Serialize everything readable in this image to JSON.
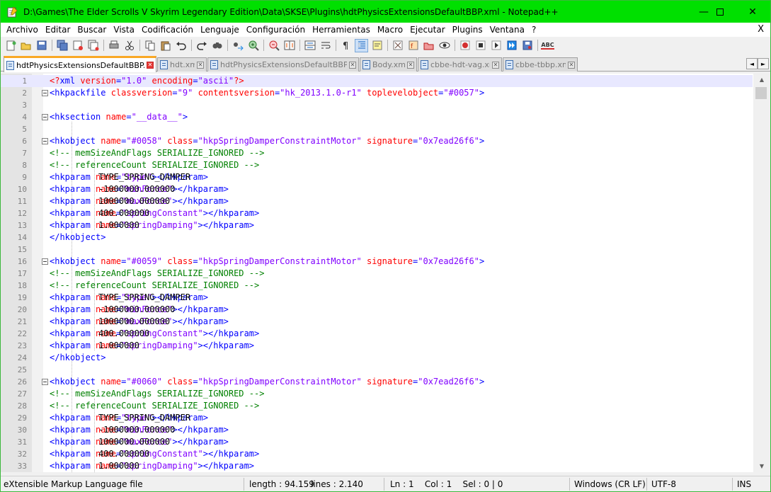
{
  "window": {
    "title": "D:\\Games\\The Elder Scrolls V Skyrim Legendary Edition\\Data\\SKSE\\Plugins\\hdtPhysicsExtensionsDefaultBBP.xml - Notepad++",
    "minimize_glyph": "—",
    "maximize_glyph": "☐",
    "close_glyph": "✕"
  },
  "menu": {
    "items": [
      "Archivo",
      "Editar",
      "Buscar",
      "Vista",
      "Codificación",
      "Lenguaje",
      "Configuración",
      "Herramientas",
      "Macro",
      "Ejecutar",
      "Plugins",
      "Ventana",
      "?"
    ],
    "close_doc": "X"
  },
  "toolbar": {
    "icons": [
      "new-file-icon",
      "open-file-icon",
      "save-icon",
      "save-all-icon",
      "close-icon",
      "close-all-icon",
      "print-icon",
      "cut-icon",
      "copy-icon",
      "paste-icon",
      "undo-icon",
      "redo-icon",
      "find-icon",
      "replace-icon",
      "zoom-in-icon",
      "zoom-out-icon",
      "sync-vertical-icon",
      "sync-horizontal-icon",
      "word-wrap-icon",
      "show-all-chars-icon",
      "indent-guide-icon",
      "language-icon",
      "doc-map-icon",
      "function-list-icon",
      "folder-workspace-icon",
      "monitoring-icon",
      "record-macro-icon",
      "stop-record-icon",
      "play-macro-icon",
      "play-multiple-icon",
      "save-macro-icon",
      "spellcheck-icon"
    ],
    "spellcheck_label": "ABC"
  },
  "tabs": [
    {
      "label": "hdtPhysicsExtensionsDefaultBBP.xml",
      "active": true
    },
    {
      "label": "hdt.xml",
      "active": false
    },
    {
      "label": "hdtPhysicsExtensionsDefaultBBP.xml",
      "active": false
    },
    {
      "label": "Body.xml",
      "active": false
    },
    {
      "label": "cbbe-hdt-vag.xml",
      "active": false
    },
    {
      "label": "cbbe-tbbp.xml",
      "active": false
    }
  ],
  "tab_nav": {
    "prev": "◄",
    "next": "►"
  },
  "editor": {
    "current_line": 1,
    "lines": [
      {
        "n": "1",
        "seg": [
          [
            "pi",
            "<?"
          ],
          [
            "tag",
            "xml "
          ],
          [
            "att",
            "version"
          ],
          [
            "tag",
            "="
          ],
          [
            "val",
            "\"1.0\""
          ],
          [
            "tag",
            " "
          ],
          [
            "att",
            "encoding"
          ],
          [
            "tag",
            "="
          ],
          [
            "val",
            "\"ascii\""
          ],
          [
            "pi",
            "?>"
          ]
        ]
      },
      {
        "n": "2",
        "seg": [
          [
            "tag",
            "<hkpackfile "
          ],
          [
            "att",
            "classversion"
          ],
          [
            "tag",
            "="
          ],
          [
            "val",
            "\"9\""
          ],
          [
            "tag",
            " "
          ],
          [
            "att",
            "contentsversion"
          ],
          [
            "tag",
            "="
          ],
          [
            "val",
            "\"hk_2013.1.0-r1\""
          ],
          [
            "tag",
            " "
          ],
          [
            "att",
            "toplevelobject"
          ],
          [
            "tag",
            "="
          ],
          [
            "val",
            "\"#0057\""
          ],
          [
            "tag",
            ">"
          ]
        ]
      },
      {
        "n": "3",
        "seg": []
      },
      {
        "n": "4",
        "seg": [
          [
            "txt",
            "    "
          ],
          [
            "tag",
            "<hksection "
          ],
          [
            "att",
            "name"
          ],
          [
            "tag",
            "="
          ],
          [
            "val",
            "\"__data__\""
          ],
          [
            "tag",
            ">"
          ]
        ]
      },
      {
        "n": "5",
        "seg": []
      },
      {
        "n": "6",
        "seg": [
          [
            "txt",
            "        "
          ],
          [
            "tag",
            "<hkobject "
          ],
          [
            "att",
            "name"
          ],
          [
            "tag",
            "="
          ],
          [
            "val",
            "\"#0058\""
          ],
          [
            "tag",
            " "
          ],
          [
            "att",
            "class"
          ],
          [
            "tag",
            "="
          ],
          [
            "val",
            "\"hkpSpringDamperConstraintMotor\""
          ],
          [
            "tag",
            " "
          ],
          [
            "att",
            "signature"
          ],
          [
            "tag",
            "="
          ],
          [
            "val",
            "\"0x7ead26f6\""
          ],
          [
            "tag",
            ">"
          ]
        ]
      },
      {
        "n": "7",
        "seg": [
          [
            "txt",
            "            "
          ],
          [
            "cmt",
            "<!-- memSizeAndFlags SERIALIZE_IGNORED -->"
          ]
        ]
      },
      {
        "n": "8",
        "seg": [
          [
            "txt",
            "            "
          ],
          [
            "cmt",
            "<!-- referenceCount SERIALIZE_IGNORED -->"
          ]
        ]
      },
      {
        "n": "9",
        "seg": [
          [
            "txt",
            "            "
          ],
          [
            "tag",
            "<hkparam "
          ],
          [
            "att",
            "name"
          ],
          [
            "tag",
            "="
          ],
          [
            "val",
            "\"type\""
          ],
          [
            "tag",
            ">"
          ],
          [
            "txt",
            "TYPE_SPRING_DAMPER"
          ],
          [
            "tag",
            "</hkparam>"
          ]
        ]
      },
      {
        "n": "10",
        "seg": [
          [
            "txt",
            "            "
          ],
          [
            "tag",
            "<hkparam "
          ],
          [
            "att",
            "name"
          ],
          [
            "tag",
            "="
          ],
          [
            "val",
            "\"minForce\""
          ],
          [
            "tag",
            ">"
          ],
          [
            "txt",
            "-1000000.000000"
          ],
          [
            "tag",
            "</hkparam>"
          ]
        ]
      },
      {
        "n": "11",
        "seg": [
          [
            "txt",
            "            "
          ],
          [
            "tag",
            "<hkparam "
          ],
          [
            "att",
            "name"
          ],
          [
            "tag",
            "="
          ],
          [
            "val",
            "\"maxForce\""
          ],
          [
            "tag",
            ">"
          ],
          [
            "txt",
            "1000000.000000"
          ],
          [
            "tag",
            "</hkparam>"
          ]
        ]
      },
      {
        "n": "12",
        "seg": [
          [
            "txt",
            "            "
          ],
          [
            "tag",
            "<hkparam "
          ],
          [
            "att",
            "name"
          ],
          [
            "tag",
            "="
          ],
          [
            "val",
            "\"springConstant\""
          ],
          [
            "tag",
            ">"
          ],
          [
            "txt",
            "400.000000"
          ],
          [
            "tag",
            "</hkparam>"
          ]
        ]
      },
      {
        "n": "13",
        "seg": [
          [
            "txt",
            "            "
          ],
          [
            "tag",
            "<hkparam "
          ],
          [
            "att",
            "name"
          ],
          [
            "tag",
            "="
          ],
          [
            "val",
            "\"springDamping\""
          ],
          [
            "tag",
            ">"
          ],
          [
            "txt",
            "1.000000"
          ],
          [
            "tag",
            "</hkparam>"
          ]
        ]
      },
      {
        "n": "14",
        "seg": [
          [
            "txt",
            "        "
          ],
          [
            "tag",
            "</hkobject>"
          ]
        ]
      },
      {
        "n": "15",
        "seg": []
      },
      {
        "n": "16",
        "seg": [
          [
            "txt",
            "        "
          ],
          [
            "tag",
            "<hkobject "
          ],
          [
            "att",
            "name"
          ],
          [
            "tag",
            "="
          ],
          [
            "val",
            "\"#0059\""
          ],
          [
            "tag",
            " "
          ],
          [
            "att",
            "class"
          ],
          [
            "tag",
            "="
          ],
          [
            "val",
            "\"hkpSpringDamperConstraintMotor\""
          ],
          [
            "tag",
            " "
          ],
          [
            "att",
            "signature"
          ],
          [
            "tag",
            "="
          ],
          [
            "val",
            "\"0x7ead26f6\""
          ],
          [
            "tag",
            ">"
          ]
        ]
      },
      {
        "n": "17",
        "seg": [
          [
            "txt",
            "            "
          ],
          [
            "cmt",
            "<!-- memSizeAndFlags SERIALIZE_IGNORED -->"
          ]
        ]
      },
      {
        "n": "18",
        "seg": [
          [
            "txt",
            "            "
          ],
          [
            "cmt",
            "<!-- referenceCount SERIALIZE_IGNORED -->"
          ]
        ]
      },
      {
        "n": "19",
        "seg": [
          [
            "txt",
            "            "
          ],
          [
            "tag",
            "<hkparam "
          ],
          [
            "att",
            "name"
          ],
          [
            "tag",
            "="
          ],
          [
            "val",
            "\"type\""
          ],
          [
            "tag",
            ">"
          ],
          [
            "txt",
            "TYPE_SPRING_DAMPER"
          ],
          [
            "tag",
            "</hkparam>"
          ]
        ]
      },
      {
        "n": "20",
        "seg": [
          [
            "txt",
            "            "
          ],
          [
            "tag",
            "<hkparam "
          ],
          [
            "att",
            "name"
          ],
          [
            "tag",
            "="
          ],
          [
            "val",
            "\"minForce\""
          ],
          [
            "tag",
            ">"
          ],
          [
            "txt",
            "-1000000.000000"
          ],
          [
            "tag",
            "</hkparam>"
          ]
        ]
      },
      {
        "n": "21",
        "seg": [
          [
            "txt",
            "            "
          ],
          [
            "tag",
            "<hkparam "
          ],
          [
            "att",
            "name"
          ],
          [
            "tag",
            "="
          ],
          [
            "val",
            "\"maxForce\""
          ],
          [
            "tag",
            ">"
          ],
          [
            "txt",
            "1000000.000000"
          ],
          [
            "tag",
            "</hkparam>"
          ]
        ]
      },
      {
        "n": "22",
        "seg": [
          [
            "txt",
            "            "
          ],
          [
            "tag",
            "<hkparam "
          ],
          [
            "att",
            "name"
          ],
          [
            "tag",
            "="
          ],
          [
            "val",
            "\"springConstant\""
          ],
          [
            "tag",
            ">"
          ],
          [
            "txt",
            "400.000000"
          ],
          [
            "tag",
            "</hkparam>"
          ]
        ]
      },
      {
        "n": "23",
        "seg": [
          [
            "txt",
            "            "
          ],
          [
            "tag",
            "<hkparam "
          ],
          [
            "att",
            "name"
          ],
          [
            "tag",
            "="
          ],
          [
            "val",
            "\"springDamping\""
          ],
          [
            "tag",
            ">"
          ],
          [
            "txt",
            "1.000000"
          ],
          [
            "tag",
            "</hkparam>"
          ]
        ]
      },
      {
        "n": "24",
        "seg": [
          [
            "txt",
            "        "
          ],
          [
            "tag",
            "</hkobject>"
          ]
        ]
      },
      {
        "n": "25",
        "seg": []
      },
      {
        "n": "26",
        "seg": [
          [
            "txt",
            "        "
          ],
          [
            "tag",
            "<hkobject "
          ],
          [
            "att",
            "name"
          ],
          [
            "tag",
            "="
          ],
          [
            "val",
            "\"#0060\""
          ],
          [
            "tag",
            " "
          ],
          [
            "att",
            "class"
          ],
          [
            "tag",
            "="
          ],
          [
            "val",
            "\"hkpSpringDamperConstraintMotor\""
          ],
          [
            "tag",
            " "
          ],
          [
            "att",
            "signature"
          ],
          [
            "tag",
            "="
          ],
          [
            "val",
            "\"0x7ead26f6\""
          ],
          [
            "tag",
            ">"
          ]
        ]
      },
      {
        "n": "27",
        "seg": [
          [
            "txt",
            "            "
          ],
          [
            "cmt",
            "<!-- memSizeAndFlags SERIALIZE_IGNORED -->"
          ]
        ]
      },
      {
        "n": "28",
        "seg": [
          [
            "txt",
            "            "
          ],
          [
            "cmt",
            "<!-- referenceCount SERIALIZE_IGNORED -->"
          ]
        ]
      },
      {
        "n": "29",
        "seg": [
          [
            "txt",
            "            "
          ],
          [
            "tag",
            "<hkparam "
          ],
          [
            "att",
            "name"
          ],
          [
            "tag",
            "="
          ],
          [
            "val",
            "\"type\""
          ],
          [
            "tag",
            ">"
          ],
          [
            "txt",
            "TYPE_SPRING_DAMPER"
          ],
          [
            "tag",
            "</hkparam>"
          ]
        ]
      },
      {
        "n": "30",
        "seg": [
          [
            "txt",
            "            "
          ],
          [
            "tag",
            "<hkparam "
          ],
          [
            "att",
            "name"
          ],
          [
            "tag",
            "="
          ],
          [
            "val",
            "\"minForce\""
          ],
          [
            "tag",
            ">"
          ],
          [
            "txt",
            "-1000000.000000"
          ],
          [
            "tag",
            "</hkparam>"
          ]
        ]
      },
      {
        "n": "31",
        "seg": [
          [
            "txt",
            "            "
          ],
          [
            "tag",
            "<hkparam "
          ],
          [
            "att",
            "name"
          ],
          [
            "tag",
            "="
          ],
          [
            "val",
            "\"maxForce\""
          ],
          [
            "tag",
            ">"
          ],
          [
            "txt",
            "1000000.000000"
          ],
          [
            "tag",
            "</hkparam>"
          ]
        ]
      },
      {
        "n": "32",
        "seg": [
          [
            "txt",
            "            "
          ],
          [
            "tag",
            "<hkparam "
          ],
          [
            "att",
            "name"
          ],
          [
            "tag",
            "="
          ],
          [
            "val",
            "\"springConstant\""
          ],
          [
            "tag",
            ">"
          ],
          [
            "txt",
            "400.000000"
          ],
          [
            "tag",
            "</hkparam>"
          ]
        ]
      },
      {
        "n": "33",
        "seg": [
          [
            "txt",
            "            "
          ],
          [
            "tag",
            "<hkparam "
          ],
          [
            "att",
            "name"
          ],
          [
            "tag",
            "="
          ],
          [
            "val",
            "\"springDamping\""
          ],
          [
            "tag",
            ">"
          ],
          [
            "txt",
            "1.000000"
          ],
          [
            "tag",
            "</hkparam>"
          ]
        ]
      }
    ],
    "fold_lines": [
      "2",
      "4",
      "6",
      "16",
      "26"
    ]
  },
  "statusbar": {
    "file_type": "eXtensible Markup Language file",
    "length": "length : 94.159",
    "lines": "lines : 2.140",
    "position": "Ln : 1    Col : 1    Sel : 0 | 0",
    "eol": "Windows (CR LF)",
    "encoding": "UTF-8",
    "insert_mode": "INS"
  },
  "colors": {
    "titlebar": "#00e000",
    "tag": "#0000ff",
    "attribute": "#ff0000",
    "value": "#8000ff",
    "comment": "#008000",
    "active_tab_accent": "#f9a825"
  }
}
